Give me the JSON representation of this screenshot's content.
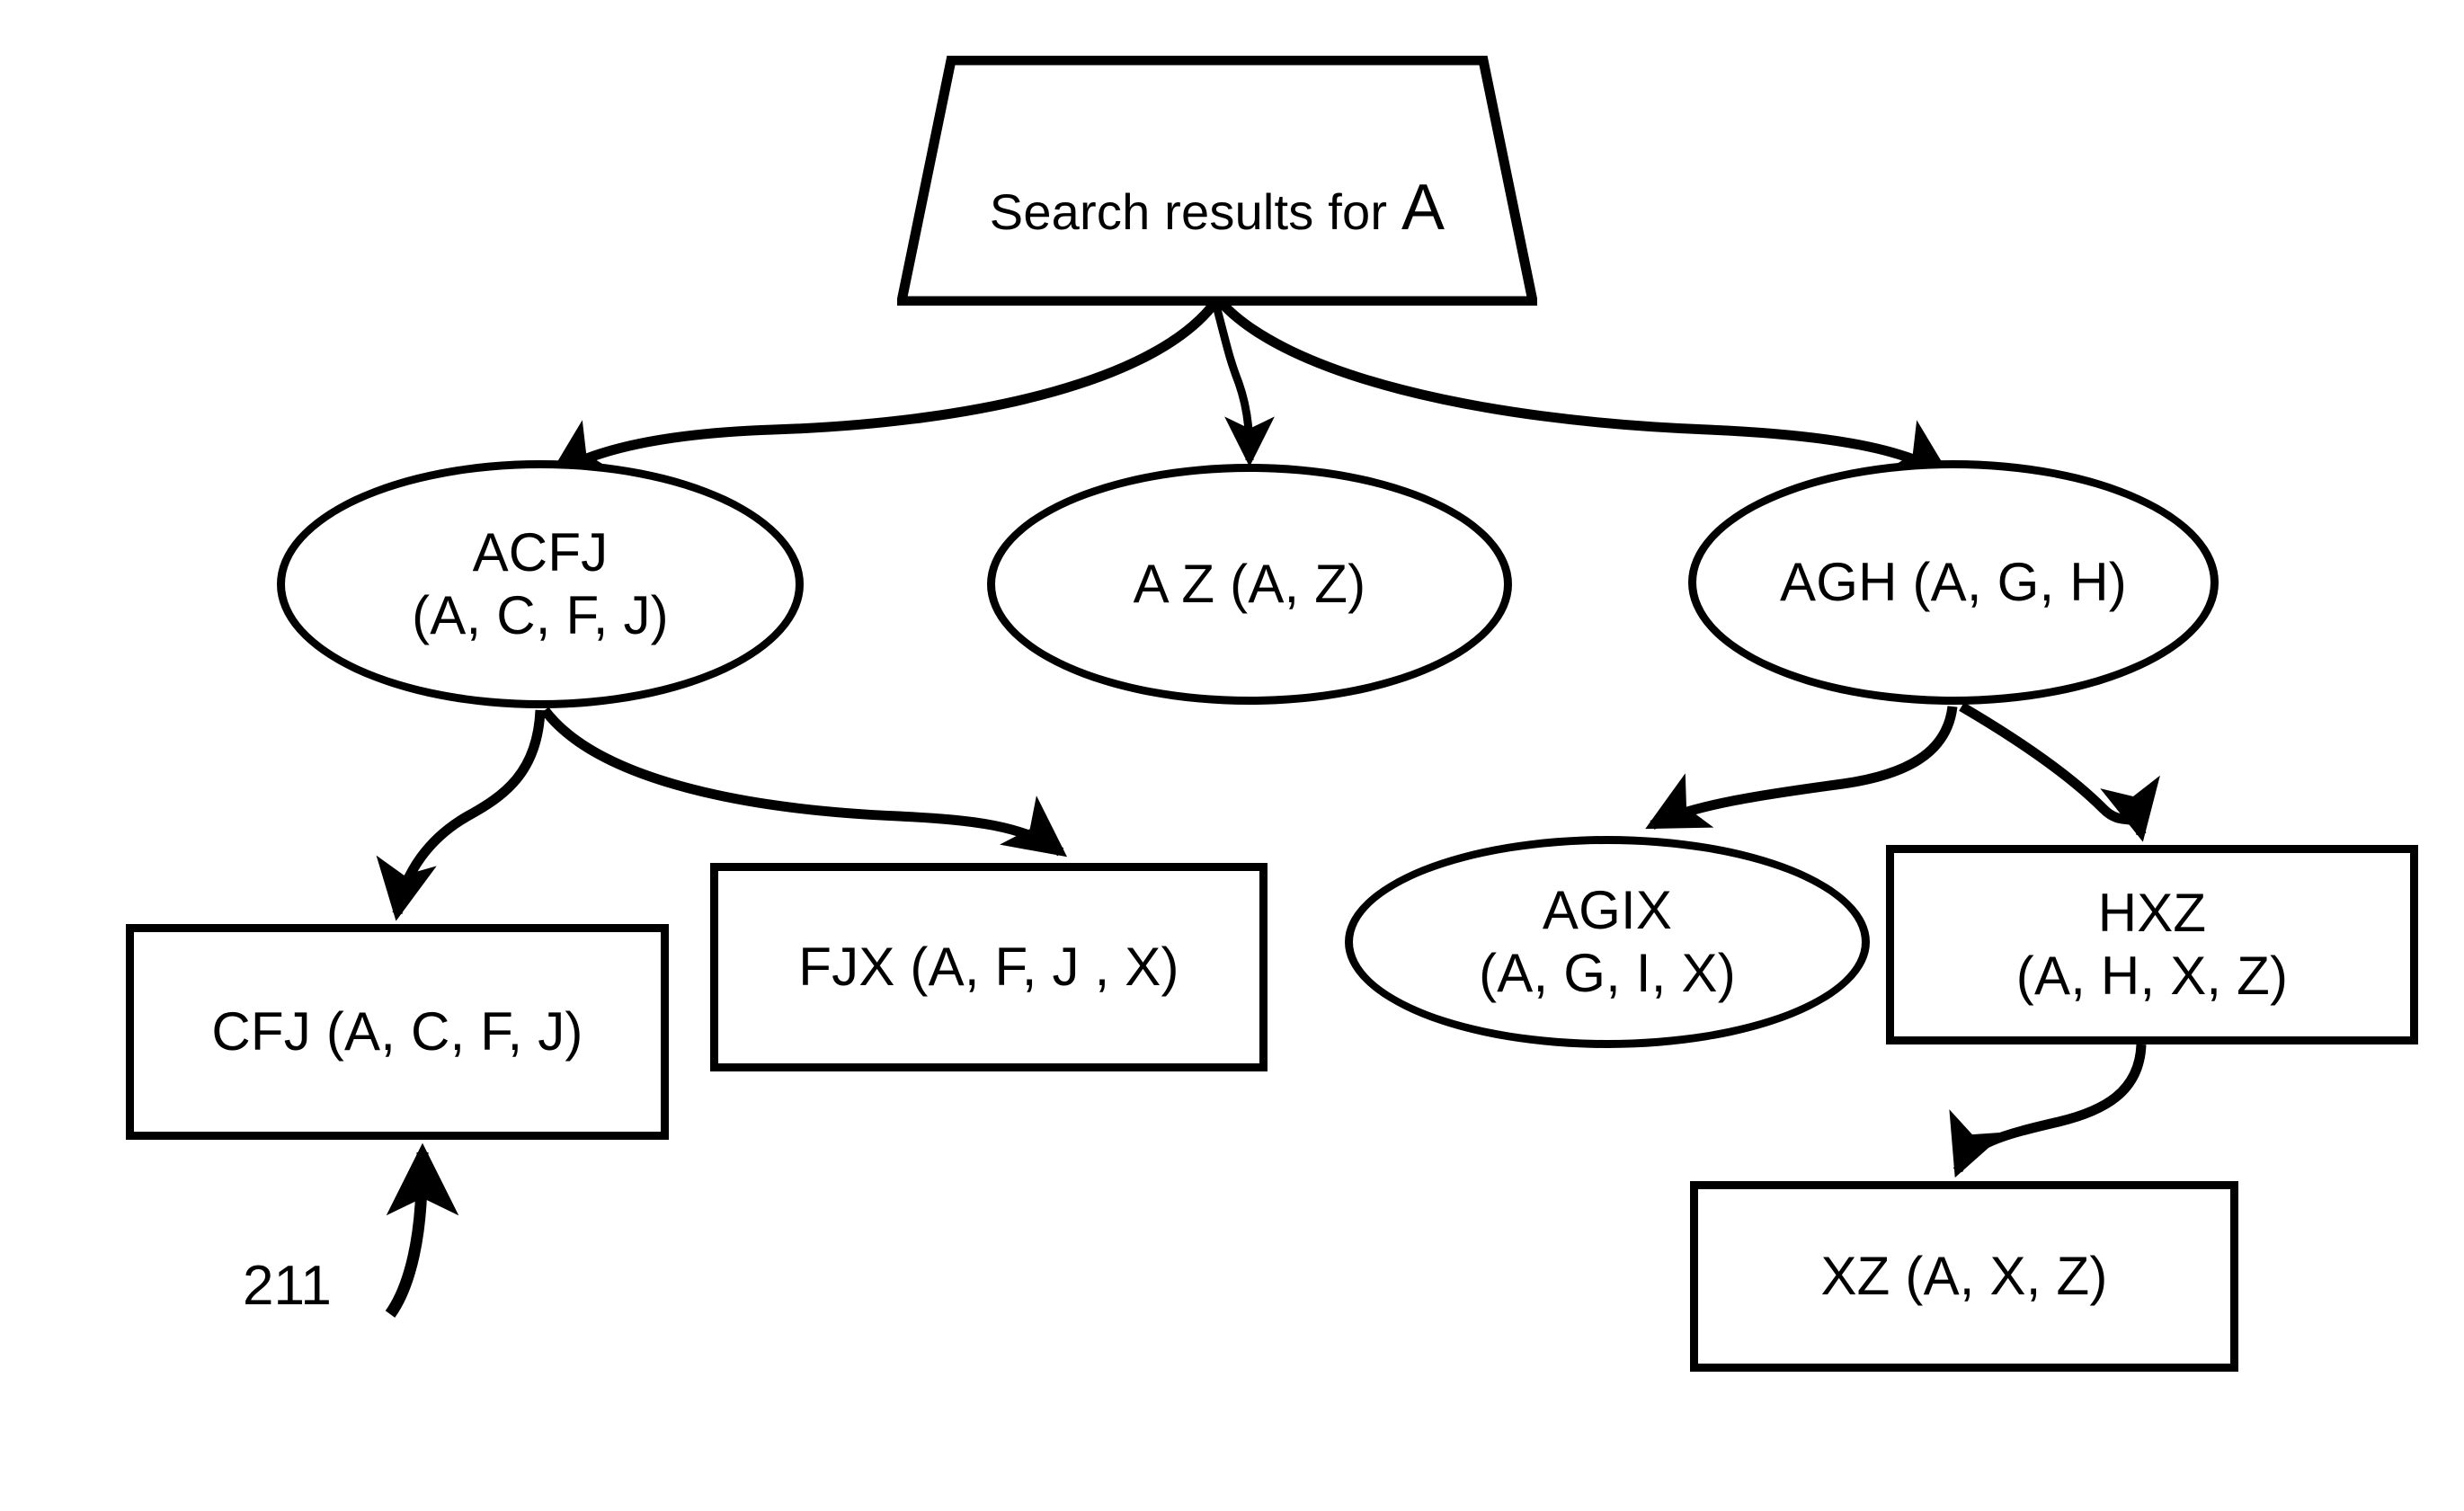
{
  "diagram": {
    "title_node": {
      "id": "root",
      "shape": "trapezoid",
      "text_prefix": "Search results for ",
      "text_term": "A",
      "full_text": "Search results for A"
    },
    "nodes": [
      {
        "id": "acfj",
        "shape": "ellipse",
        "label": "ACFJ\n(A, C, F, J)"
      },
      {
        "id": "az",
        "shape": "ellipse",
        "label": "A Z (A, Z)"
      },
      {
        "id": "agh",
        "shape": "ellipse",
        "label": "AGH (A, G, H)"
      },
      {
        "id": "cfj",
        "shape": "rectangle",
        "label": "CFJ (A, C, F, J)"
      },
      {
        "id": "fjx",
        "shape": "rectangle",
        "label": "FJX (A, F, J , X)"
      },
      {
        "id": "agix",
        "shape": "ellipse",
        "label": "AGIX\n(A, G, I, X)"
      },
      {
        "id": "hxz",
        "shape": "rectangle",
        "label": "HXZ\n(A, H, X, Z)"
      },
      {
        "id": "xz",
        "shape": "rectangle",
        "label": "XZ (A, X, Z)"
      }
    ],
    "edges": [
      {
        "from": "root",
        "to": "acfj"
      },
      {
        "from": "root",
        "to": "az"
      },
      {
        "from": "root",
        "to": "agh"
      },
      {
        "from": "acfj",
        "to": "cfj"
      },
      {
        "from": "acfj",
        "to": "fjx"
      },
      {
        "from": "agh",
        "to": "agix"
      },
      {
        "from": "agh",
        "to": "hxz"
      },
      {
        "from": "hxz",
        "to": "xz"
      }
    ],
    "callouts": [
      {
        "id": "211",
        "label": "211",
        "points_to": "cfj"
      }
    ],
    "colors": {
      "stroke": "#000000",
      "fill": "#ffffff",
      "text": "#000000"
    }
  }
}
